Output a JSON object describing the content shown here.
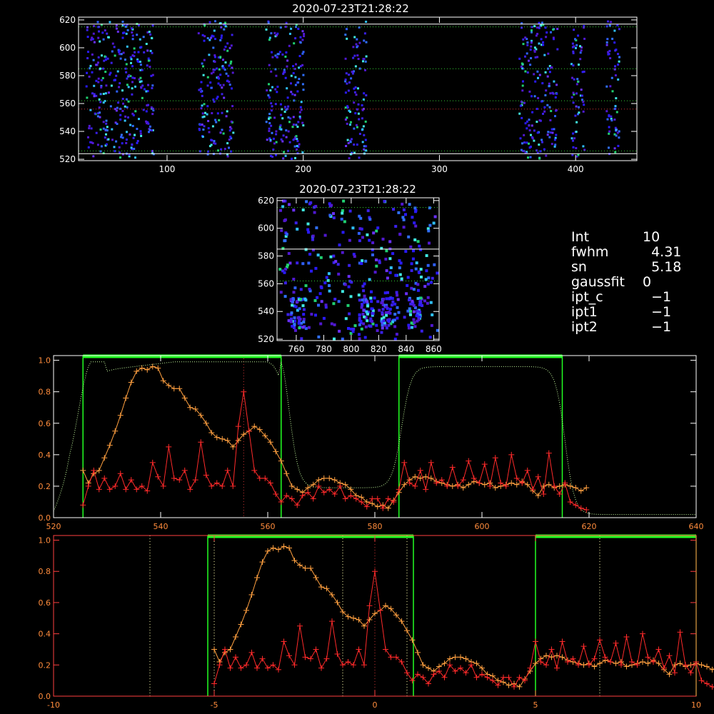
{
  "chart_data": [
    {
      "type": "heatmap",
      "title": "2020-07-23T21:28:22",
      "xlim": [
        35,
        445
      ],
      "ylim": [
        519,
        622
      ],
      "x_ticks": [
        "100",
        "200",
        "300",
        "400"
      ],
      "y_ticks": [
        "520",
        "540",
        "560",
        "580",
        "600",
        "620"
      ],
      "clusters": [
        [
          40,
          90
        ],
        [
          122,
          148
        ],
        [
          172,
          200
        ],
        [
          230,
          246
        ],
        [
          358,
          386
        ],
        [
          396,
          406
        ],
        [
          422,
          432
        ]
      ],
      "hlines": [
        {
          "y": 617,
          "color": "#ffffff",
          "style": "solid"
        },
        {
          "y": 615,
          "color": "#33cc33",
          "style": "dotted"
        },
        {
          "y": 585,
          "color": "#33cc33",
          "style": "dotted"
        },
        {
          "y": 562,
          "color": "#33cc33",
          "style": "dotted"
        },
        {
          "y": 556,
          "color": "#cc3333",
          "style": "dotted"
        },
        {
          "y": 526,
          "color": "#33cc33",
          "style": "dotted"
        },
        {
          "y": 524,
          "color": "#ffffff",
          "style": "solid"
        }
      ]
    },
    {
      "type": "heatmap",
      "title": "2020-07-23T21:28:22",
      "xlim": [
        746,
        864
      ],
      "ylim": [
        519,
        622
      ],
      "x_ticks": [
        "760",
        "780",
        "800",
        "820",
        "840",
        "860"
      ],
      "y_ticks": [
        "520",
        "540",
        "560",
        "580",
        "600",
        "620"
      ],
      "hlines": [
        {
          "y": 615,
          "color": "#33cc33",
          "style": "dotted"
        },
        {
          "y": 585,
          "color": "#ffffff",
          "style": "solid"
        },
        {
          "y": 562,
          "color": "#33cc33",
          "style": "dotted"
        }
      ]
    },
    {
      "type": "line",
      "xlim": [
        520,
        640
      ],
      "ylim": [
        0,
        1.03
      ],
      "x_ticks": [
        "520",
        "540",
        "560",
        "580",
        "600",
        "620",
        "640"
      ],
      "y_ticks": [
        "0.0",
        "0.2",
        "0.4",
        "0.6",
        "0.8",
        "1.0"
      ],
      "bands": [
        [
          525.5,
          562.5
        ],
        [
          584.5,
          615
        ]
      ],
      "vlines": [
        {
          "x": 555.5,
          "color": "#cc3333"
        }
      ],
      "series": [
        {
          "color": "#ffa040",
          "marker": "plus",
          "x": [
            525.5,
            526.5,
            527.5,
            528.5,
            529.5,
            530.5,
            531.5,
            532.5,
            533.5,
            534.5,
            535.5,
            536.5,
            537.5,
            538.5,
            539.5,
            540.5,
            541.5,
            542.5,
            543.5,
            544.5,
            545.5,
            546.5,
            547.5,
            548.5,
            549.5,
            550.5,
            551.5,
            552.5,
            553.5,
            554.5,
            555.5,
            556.5,
            557.5,
            558.5,
            559.5,
            560.5,
            561.5,
            562.5,
            563.5,
            564.5,
            565.5,
            566.5,
            567.5,
            568.5,
            569.5,
            570.5,
            571.5,
            572.5,
            573.5,
            574.5,
            575.5,
            576.5,
            577.5,
            578.5,
            579.5,
            580.5,
            581.5,
            582.5,
            583.5,
            584.5,
            585.5,
            586.5,
            587.5,
            588.5,
            589.5,
            590.5,
            591.5,
            592.5,
            593.5,
            594.5,
            595.5,
            596.5,
            597.5,
            598.5,
            599.5,
            600.5,
            601.5,
            602.5,
            603.5,
            604.5,
            605.5,
            606.5,
            607.5,
            608.5,
            609.5,
            610.5,
            611.5,
            612.5,
            613.5,
            614.5,
            615.5,
            616.5,
            617.5,
            618.5,
            619.5
          ],
          "y": [
            0.3,
            0.22,
            0.28,
            0.3,
            0.38,
            0.46,
            0.55,
            0.65,
            0.76,
            0.86,
            0.93,
            0.95,
            0.94,
            0.96,
            0.95,
            0.87,
            0.84,
            0.82,
            0.82,
            0.76,
            0.7,
            0.69,
            0.65,
            0.6,
            0.54,
            0.51,
            0.5,
            0.49,
            0.45,
            0.49,
            0.53,
            0.55,
            0.58,
            0.56,
            0.52,
            0.48,
            0.42,
            0.36,
            0.28,
            0.2,
            0.18,
            0.16,
            0.19,
            0.21,
            0.24,
            0.25,
            0.25,
            0.24,
            0.22,
            0.21,
            0.18,
            0.14,
            0.13,
            0.1,
            0.09,
            0.07,
            0.08,
            0.06,
            0.11,
            0.16,
            0.21,
            0.24,
            0.26,
            0.25,
            0.26,
            0.25,
            0.23,
            0.22,
            0.21,
            0.2,
            0.21,
            0.19,
            0.21,
            0.23,
            0.22,
            0.21,
            0.22,
            0.19,
            0.2,
            0.21,
            0.22,
            0.21,
            0.23,
            0.21,
            0.17,
            0.14,
            0.2,
            0.21,
            0.19,
            0.2,
            0.21,
            0.2,
            0.19,
            0.17,
            0.19
          ]
        },
        {
          "color": "#ff2a2a",
          "marker": "plus",
          "x": [
            525.5,
            526.5,
            527.5,
            528.5,
            529.5,
            530.5,
            531.5,
            532.5,
            533.5,
            534.5,
            535.5,
            536.5,
            537.5,
            538.5,
            539.5,
            540.5,
            541.5,
            542.5,
            543.5,
            544.5,
            545.5,
            546.5,
            547.5,
            548.5,
            549.5,
            550.5,
            551.5,
            552.5,
            553.5,
            554.5,
            555.5,
            556.5,
            557.5,
            558.5,
            559.5,
            560.5,
            561.5,
            562.5,
            563.5,
            564.5,
            565.5,
            566.5,
            567.5,
            568.5,
            569.5,
            570.5,
            571.5,
            572.5,
            573.5,
            574.5,
            575.5,
            576.5,
            577.5,
            578.5,
            579.5,
            580.5,
            581.5,
            582.5,
            583.5,
            584.5,
            585.5,
            586.5,
            587.5,
            588.5,
            589.5,
            590.5,
            591.5,
            592.5,
            593.5,
            594.5,
            595.5,
            596.5,
            597.5,
            598.5,
            599.5,
            600.5,
            601.5,
            602.5,
            603.5,
            604.5,
            605.5,
            606.5,
            607.5,
            608.5,
            609.5,
            610.5,
            611.5,
            612.5,
            613.5,
            614.5,
            615.5,
            616.5,
            617.5,
            618.5,
            619.5
          ],
          "y": [
            0.08,
            0.2,
            0.3,
            0.18,
            0.25,
            0.18,
            0.2,
            0.28,
            0.18,
            0.24,
            0.18,
            0.2,
            0.17,
            0.35,
            0.26,
            0.2,
            0.45,
            0.25,
            0.24,
            0.3,
            0.18,
            0.24,
            0.48,
            0.27,
            0.2,
            0.22,
            0.2,
            0.3,
            0.2,
            0.58,
            0.8,
            0.55,
            0.3,
            0.25,
            0.25,
            0.22,
            0.15,
            0.1,
            0.14,
            0.12,
            0.08,
            0.14,
            0.16,
            0.12,
            0.2,
            0.16,
            0.18,
            0.15,
            0.2,
            0.12,
            0.14,
            0.12,
            0.1,
            0.07,
            0.12,
            0.12,
            0.06,
            0.12,
            0.1,
            0.18,
            0.35,
            0.22,
            0.2,
            0.3,
            0.18,
            0.35,
            0.22,
            0.24,
            0.2,
            0.32,
            0.2,
            0.24,
            0.36,
            0.25,
            0.22,
            0.34,
            0.2,
            0.38,
            0.22,
            0.2,
            0.4,
            0.25,
            0.22,
            0.3,
            0.18,
            0.26,
            0.15,
            0.41,
            0.2,
            0.15,
            0.22,
            0.1,
            0.08,
            0.06,
            0.05
          ]
        },
        {
          "color": "#c8ffa0",
          "style": "dotted",
          "curve": "filter"
        }
      ]
    },
    {
      "type": "line",
      "xlim": [
        -10,
        10
      ],
      "ylim": [
        0,
        1.03
      ],
      "x_ticks": [
        "-10",
        "-5",
        "0",
        "5",
        "10"
      ],
      "y_ticks": [
        "0.0",
        "0.2",
        "0.4",
        "0.6",
        "0.8",
        "1.0"
      ],
      "bands": [
        [
          -5.2,
          1.2
        ],
        [
          5.0,
          10
        ]
      ],
      "vlines": [
        {
          "x": -7,
          "color": "#ffffaa"
        },
        {
          "x": -5,
          "color": "#ffffaa"
        },
        {
          "x": -1,
          "color": "#ffffaa"
        },
        {
          "x": 1,
          "color": "#ffffaa"
        },
        {
          "x": 7,
          "color": "#ffffaa"
        },
        {
          "x": 0,
          "color": "#cc3333"
        }
      ],
      "x_offset": 555.5,
      "x_scale": 6.0
    }
  ],
  "info": {
    "rows": [
      {
        "k": "Int",
        "v": "10"
      },
      {
        "k": "fwhm",
        "v": "  4.31"
      },
      {
        "k": "sn",
        "v": "  5.18"
      },
      {
        "k": "gaussfit",
        "v": "0"
      },
      {
        "k": "ipt_c",
        "v": "  −1"
      },
      {
        "k": "ipt1",
        "v": "  −1"
      },
      {
        "k": "ipt2",
        "v": "  −1"
      }
    ]
  }
}
